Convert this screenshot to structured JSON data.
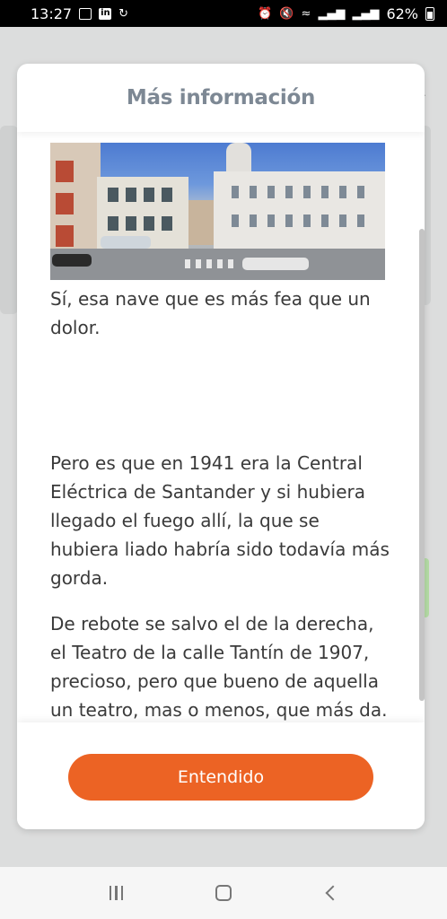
{
  "status_bar": {
    "time": "13:27",
    "battery": "62%",
    "icons": [
      "image-icon",
      "linkedin-icon",
      "sync-icon",
      "alarm-icon",
      "mute-icon",
      "wifi-icon",
      "signal-icon",
      "signal-icon",
      "battery-icon"
    ]
  },
  "modal": {
    "title": "Más información",
    "image": {
      "name": "street-photo",
      "description_visible": false
    },
    "paragraphs": [
      "Sí, esa nave que es más fea que un dolor.",
      "Pero es que en 1941 era la Central Eléctrica de Santander y si hubiera llegado el fuego allí, la que se hubiera liado habría sido todavía más gorda.",
      "De rebote se salvo el de la derecha, el Teatro de la calle Tantín de 1907, precioso, pero que bueno de aquella un teatro, mas o menos, que más da."
    ],
    "button_label": "Entendido",
    "button_color": "#ec6324",
    "title_color": "#7d8894"
  },
  "nav_bar": {
    "buttons": [
      "recents-icon",
      "home-icon",
      "back-icon"
    ]
  }
}
